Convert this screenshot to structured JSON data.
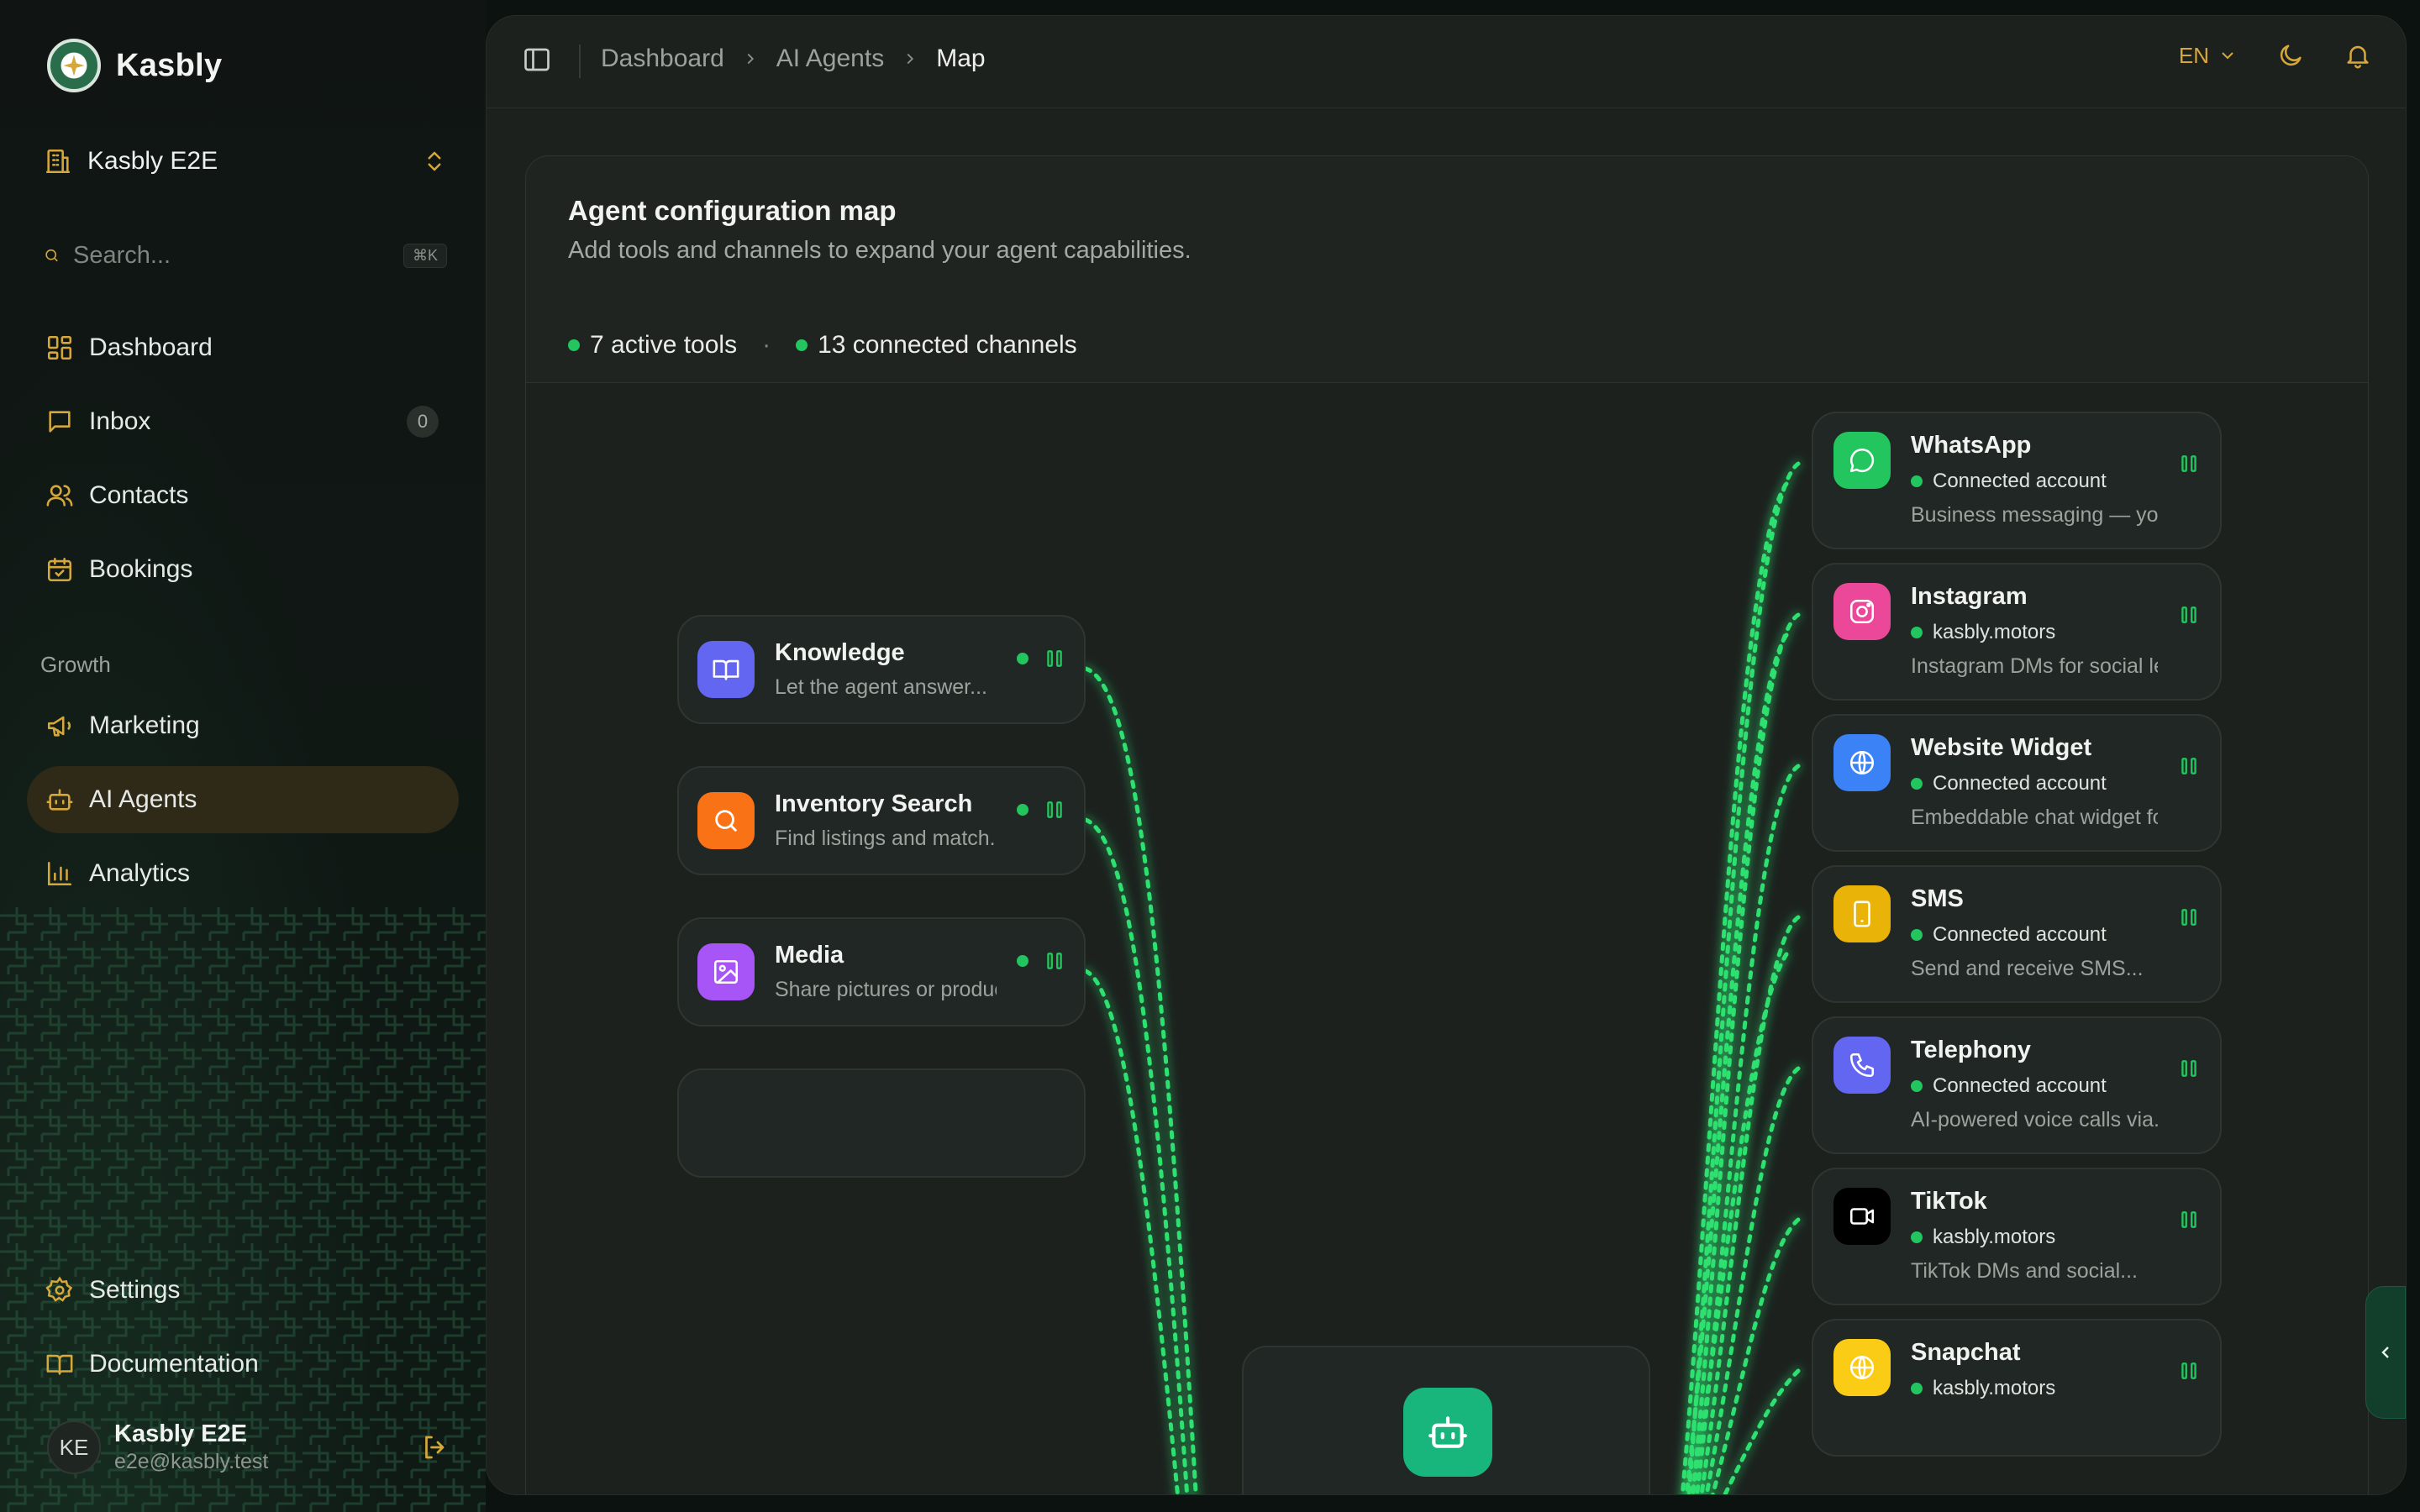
{
  "brand": {
    "name": "Kasbly"
  },
  "workspace": {
    "name": "Kasbly E2E"
  },
  "search": {
    "placeholder": "Search...",
    "shortcut": "⌘K"
  },
  "nav": {
    "dashboard": "Dashboard",
    "inbox": "Inbox",
    "inbox_count": "0",
    "contacts": "Contacts",
    "bookings": "Bookings",
    "growth_label": "Growth",
    "marketing": "Marketing",
    "ai_agents": "AI Agents",
    "analytics": "Analytics",
    "settings": "Settings",
    "documentation": "Documentation"
  },
  "user": {
    "initials": "KE",
    "name": "Kasbly E2E",
    "email": "e2e@kasbly.test"
  },
  "breadcrumb": [
    "Dashboard",
    "AI Agents",
    "Map"
  ],
  "topbar": {
    "language": "EN"
  },
  "card": {
    "title": "Agent configuration map",
    "subtitle": "Add tools and channels to expand your agent capabilities.",
    "active_tools": "7 active tools",
    "separator": "·",
    "connected_channels": "13 connected channels"
  },
  "tools": [
    {
      "name": "Knowledge",
      "desc": "Let the agent answer...",
      "icon": "book-icon",
      "color": "#6366f1"
    },
    {
      "name": "Inventory Search",
      "desc": "Find listings and match...",
      "icon": "search-icon",
      "color": "#f97316"
    },
    {
      "name": "Media",
      "desc": "Share pictures or product...",
      "icon": "image-icon",
      "color": "#a855f7"
    }
  ],
  "channels": [
    {
      "name": "WhatsApp",
      "account": "Connected account",
      "desc": "Business messaging — your...",
      "icon": "chat-icon",
      "color": "#22c55e"
    },
    {
      "name": "Instagram",
      "account": "kasbly.motors",
      "desc": "Instagram DMs for social lea...",
      "icon": "instagram-icon",
      "color": "#ec4899"
    },
    {
      "name": "Website Widget",
      "account": "Connected account",
      "desc": "Embeddable chat widget for...",
      "icon": "globe-icon",
      "color": "#3b82f6"
    },
    {
      "name": "SMS",
      "account": "Connected account",
      "desc": "Send and receive SMS...",
      "icon": "phone-device-icon",
      "color": "#eab308"
    },
    {
      "name": "Telephony",
      "account": "Connected account",
      "desc": "AI-powered voice calls via...",
      "icon": "phone-icon",
      "color": "#6366f1"
    },
    {
      "name": "TikTok",
      "account": "kasbly.motors",
      "desc": "TikTok DMs and social...",
      "icon": "video-icon",
      "color": "#000000"
    },
    {
      "name": "Snapchat",
      "account": "kasbly.motors",
      "desc": "",
      "icon": "globe-icon",
      "color": "#facc15"
    }
  ],
  "colors": {
    "accent": "#d6a73a",
    "success": "#22c55e",
    "agent": "#18b57c"
  }
}
